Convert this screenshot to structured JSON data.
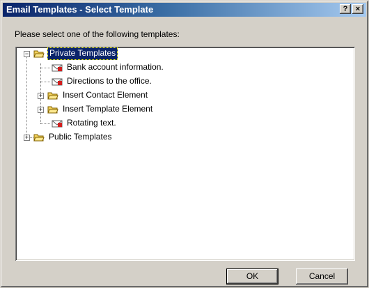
{
  "window": {
    "title": "Email Templates - Select Template",
    "help_label": "?",
    "close_label": "×"
  },
  "prompt": "Please select one of the following templates:",
  "tree": {
    "private_templates": "Private Templates",
    "bank_account": "Bank account information.",
    "directions": "Directions to the office.",
    "insert_contact": "Insert Contact Element",
    "insert_template": "Insert Template Element",
    "rotating_text": "Rotating text.",
    "public_templates": "Public Templates",
    "expanded_symbol": "−",
    "collapsed_symbol": "+"
  },
  "buttons": {
    "ok": "OK",
    "cancel": "Cancel"
  },
  "colors": {
    "selection": "#0a246a",
    "titlebar_start": "#0a246a",
    "titlebar_end": "#a6caf0",
    "folder": "#f4d35e",
    "envelope_badge": "#d21f1f"
  },
  "icons": {
    "folder": "open-folder-icon",
    "template": "email-template-icon"
  }
}
